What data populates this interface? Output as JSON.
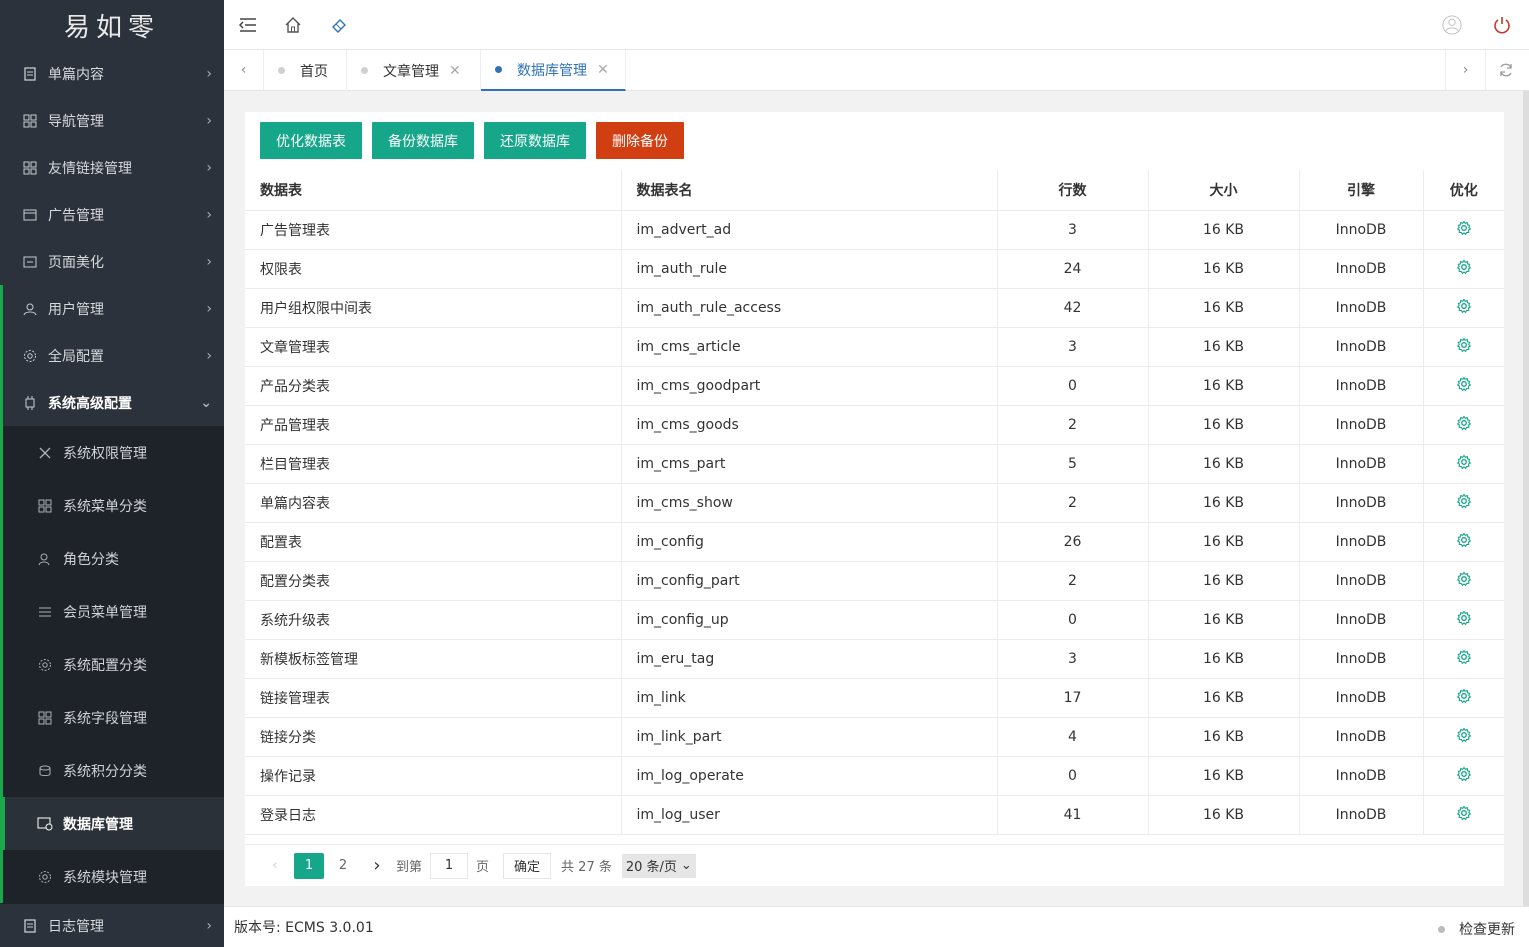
{
  "logo": "易如零",
  "sidebar": {
    "items": [
      {
        "label": "单篇内容"
      },
      {
        "label": "导航管理"
      },
      {
        "label": "友情链接管理"
      },
      {
        "label": "广告管理"
      },
      {
        "label": "页面美化"
      },
      {
        "label": "用户管理"
      },
      {
        "label": "全局配置"
      },
      {
        "label": "系统高级配置"
      }
    ],
    "sub_items": [
      {
        "label": "系统权限管理"
      },
      {
        "label": "系统菜单分类"
      },
      {
        "label": "角色分类"
      },
      {
        "label": "会员菜单管理"
      },
      {
        "label": "系统配置分类"
      },
      {
        "label": "系统字段管理"
      },
      {
        "label": "系统积分分类"
      },
      {
        "label": "数据库管理"
      },
      {
        "label": "系统模块管理"
      }
    ],
    "log_item": {
      "label": "日志管理"
    }
  },
  "tabs": [
    {
      "label": "首页"
    },
    {
      "label": "文章管理"
    },
    {
      "label": "数据库管理"
    }
  ],
  "toolbar": {
    "optimize": "优化数据表",
    "backup": "备份数据库",
    "restore": "还原数据库",
    "delete_backup": "删除备份"
  },
  "table": {
    "headers": [
      "数据表",
      "数据表名",
      "行数",
      "大小",
      "引擎",
      "优化"
    ],
    "rows": [
      {
        "desc": "广告管理表",
        "name": "im_advert_ad",
        "rows": "3",
        "size": "16 KB",
        "engine": "InnoDB"
      },
      {
        "desc": "权限表",
        "name": "im_auth_rule",
        "rows": "24",
        "size": "16 KB",
        "engine": "InnoDB"
      },
      {
        "desc": "用户组权限中间表",
        "name": "im_auth_rule_access",
        "rows": "42",
        "size": "16 KB",
        "engine": "InnoDB"
      },
      {
        "desc": "文章管理表",
        "name": "im_cms_article",
        "rows": "3",
        "size": "16 KB",
        "engine": "InnoDB"
      },
      {
        "desc": "产品分类表",
        "name": "im_cms_goodpart",
        "rows": "0",
        "size": "16 KB",
        "engine": "InnoDB"
      },
      {
        "desc": "产品管理表",
        "name": "im_cms_goods",
        "rows": "2",
        "size": "16 KB",
        "engine": "InnoDB"
      },
      {
        "desc": "栏目管理表",
        "name": "im_cms_part",
        "rows": "5",
        "size": "16 KB",
        "engine": "InnoDB"
      },
      {
        "desc": "单篇内容表",
        "name": "im_cms_show",
        "rows": "2",
        "size": "16 KB",
        "engine": "InnoDB"
      },
      {
        "desc": "配置表",
        "name": "im_config",
        "rows": "26",
        "size": "16 KB",
        "engine": "InnoDB"
      },
      {
        "desc": "配置分类表",
        "name": "im_config_part",
        "rows": "2",
        "size": "16 KB",
        "engine": "InnoDB"
      },
      {
        "desc": "系统升级表",
        "name": "im_config_up",
        "rows": "0",
        "size": "16 KB",
        "engine": "InnoDB"
      },
      {
        "desc": "新模板标签管理",
        "name": "im_eru_tag",
        "rows": "3",
        "size": "16 KB",
        "engine": "InnoDB"
      },
      {
        "desc": "链接管理表",
        "name": "im_link",
        "rows": "17",
        "size": "16 KB",
        "engine": "InnoDB"
      },
      {
        "desc": "链接分类",
        "name": "im_link_part",
        "rows": "4",
        "size": "16 KB",
        "engine": "InnoDB"
      },
      {
        "desc": "操作记录",
        "name": "im_log_operate",
        "rows": "0",
        "size": "16 KB",
        "engine": "InnoDB"
      },
      {
        "desc": "登录日志",
        "name": "im_log_user",
        "rows": "41",
        "size": "16 KB",
        "engine": "InnoDB"
      }
    ]
  },
  "pager": {
    "page1": "1",
    "page2": "2",
    "goto": "到第",
    "goto_value": "1",
    "page_unit": "页",
    "confirm": "确定",
    "total": "共 27 条",
    "per_page": "20 条/页"
  },
  "footer": {
    "version": "版本号: ECMS 3.0.01",
    "check_update": "检查更新"
  }
}
